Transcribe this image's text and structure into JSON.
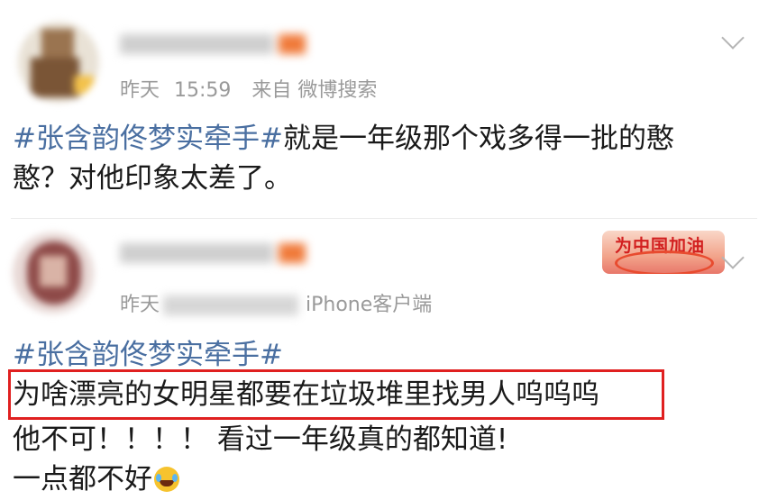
{
  "posts": [
    {
      "meta": {
        "date": "昨天",
        "time": "15:59",
        "source": "来自 微博搜索"
      },
      "text": {
        "hashtag": "#张含韵佟梦实牵手#",
        "body_line1": "就是一年级那个戏多得一批的憨",
        "body_line2": "憨？对他印象太差了。"
      }
    },
    {
      "badge": "为中国加油",
      "meta": {
        "date": "昨天",
        "source": "iPhone客户端"
      },
      "text": {
        "hashtag": "#张含韵佟梦实牵手#",
        "highlighted": "为啥漂亮的女明星都要在垃圾堆里找男人呜呜呜",
        "line2": "他不可！！！！ 看过一年级真的都知道!",
        "line3": "一点都不好"
      }
    }
  ],
  "colors": {
    "hashtag": "#4a6fa1",
    "meta": "#9a9a9a",
    "highlight_border": "#e02020"
  },
  "icons": [
    "chevron-down-icon",
    "laugh-cry-emoji-icon"
  ]
}
